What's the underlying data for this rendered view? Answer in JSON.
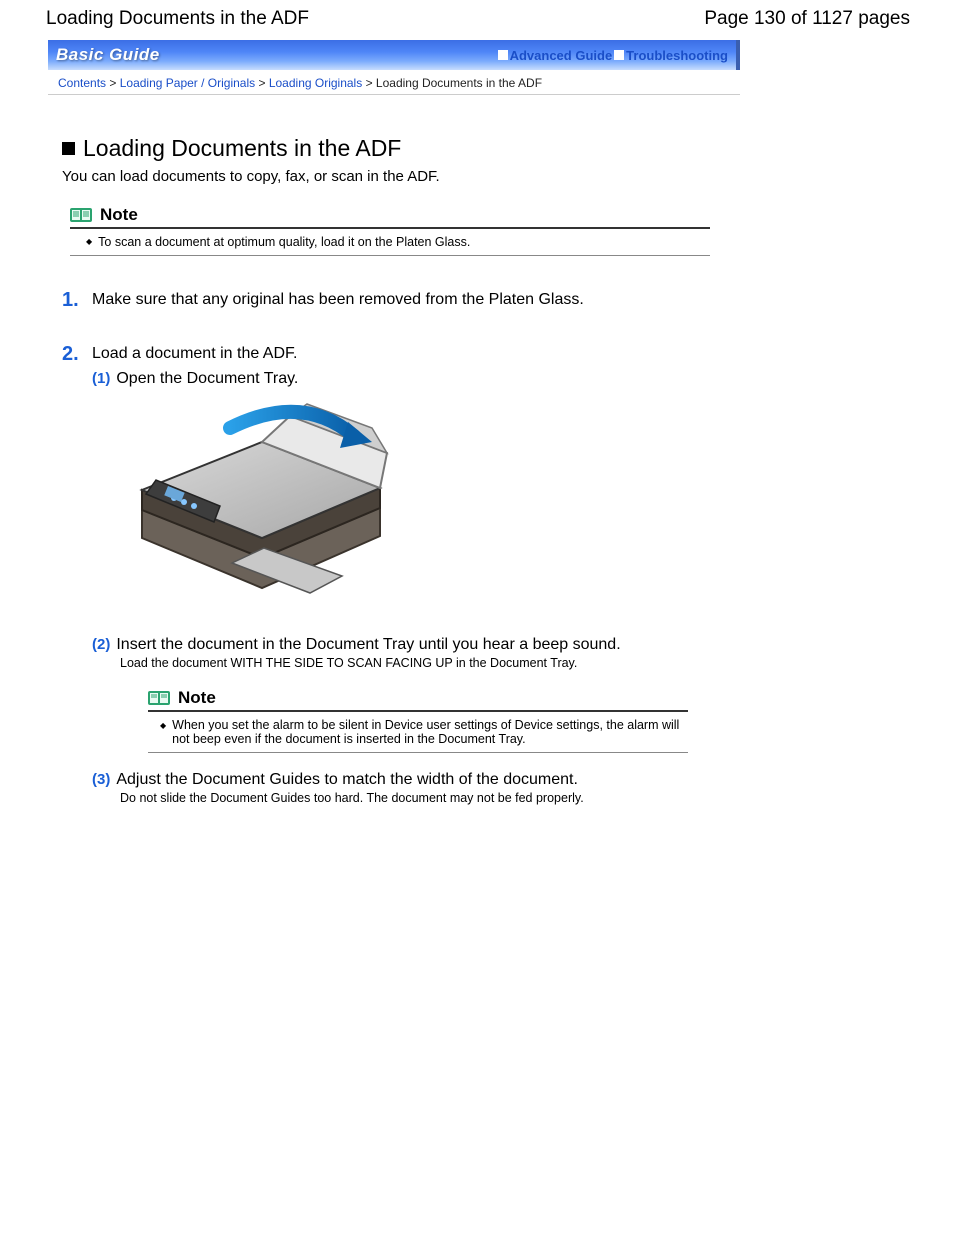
{
  "header": {
    "doc_title": "Loading Documents in the ADF",
    "page_indicator": "Page 130 of 1127 pages"
  },
  "guide_bar": {
    "title": "Basic Guide",
    "links": {
      "advanced": "Advanced Guide",
      "troubleshooting": "Troubleshooting"
    }
  },
  "breadcrumb": {
    "contents": "Contents",
    "lvl1": "Loading Paper / Originals",
    "lvl2": "Loading Originals",
    "current": "Loading Documents in the ADF",
    "sep": " > "
  },
  "main": {
    "h1": "Loading Documents in the ADF",
    "intro": "You can load documents to copy, fax, or scan in the ADF.",
    "note1": {
      "title": "Note",
      "body": "To scan a document at optimum quality, load it on the Platen Glass."
    },
    "steps": [
      {
        "num": "1.",
        "text": "Make sure that any original has been removed from the Platen Glass."
      },
      {
        "num": "2.",
        "text": "Load a document in the ADF.",
        "substeps": [
          {
            "num": "(1)",
            "text": "Open the Document Tray."
          },
          {
            "num": "(2)",
            "text": "Insert the document in the Document Tray until you hear a beep sound.",
            "detail": "Load the document WITH THE SIDE TO SCAN FACING UP in the Document Tray.",
            "note": {
              "title": "Note",
              "body": "When you set the alarm to be silent in Device user settings of Device settings, the alarm will not beep even if the document is inserted in the Document Tray."
            }
          },
          {
            "num": "(3)",
            "text": "Adjust the Document Guides to match the width of the document.",
            "detail": "Do not slide the Document Guides too hard. The document may not be fed properly."
          }
        ]
      }
    ]
  }
}
